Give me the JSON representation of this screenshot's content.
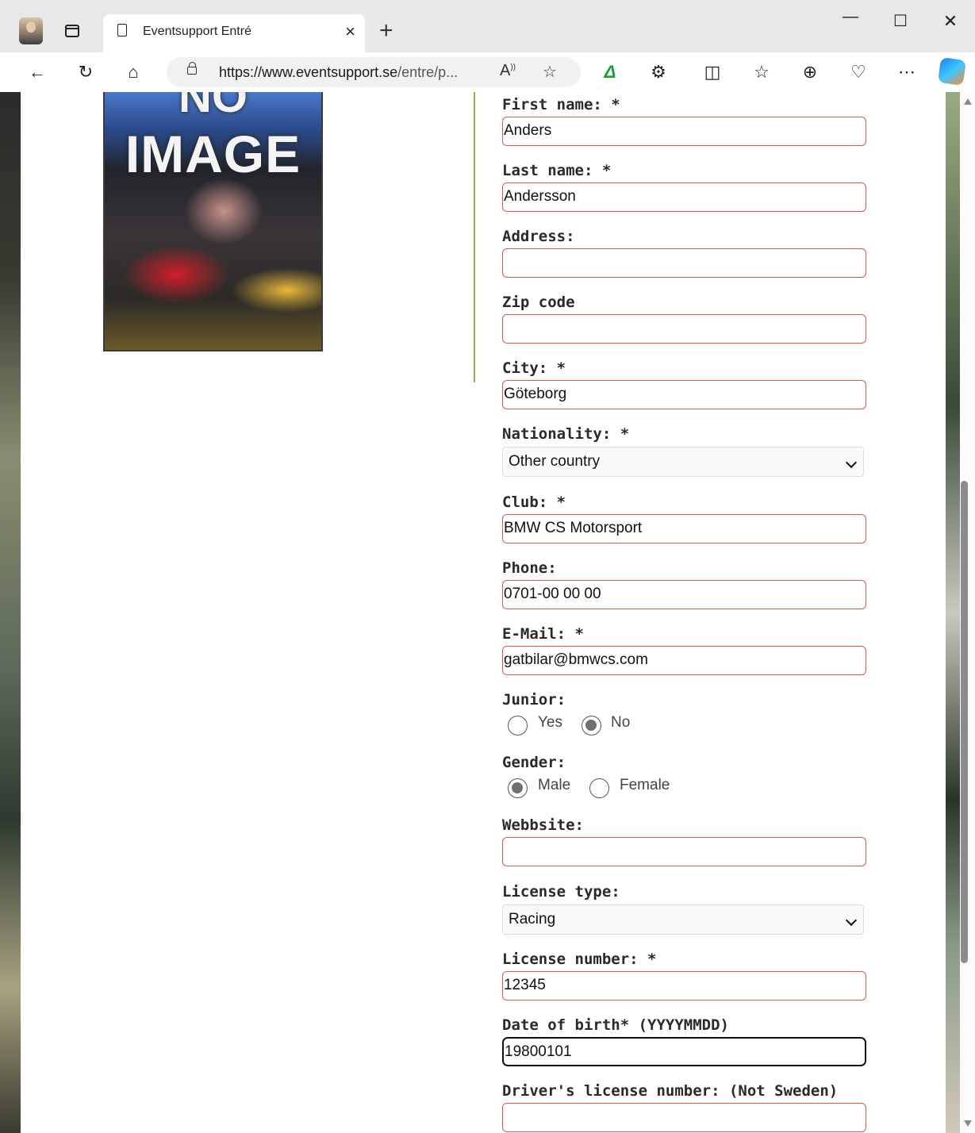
{
  "browser": {
    "tab_title": "Eventsupport Entré",
    "url_host": "https://www.eventsupport.se",
    "url_rest": "/entre/p...",
    "icons": [
      "back-icon",
      "refresh-icon",
      "home-icon",
      "lock-icon",
      "read-aloud-icon",
      "favorite-star-icon",
      "grammar-extension-icon",
      "extensions-icon",
      "split-screen-icon",
      "favorites-icon",
      "collections-icon",
      "browser-essentials-icon",
      "more-icon",
      "copilot-icon"
    ]
  },
  "image": {
    "line1": "NO",
    "line2": "IMAGE"
  },
  "form": {
    "first_name": {
      "label": "First name: *",
      "value": "Anders"
    },
    "last_name": {
      "label": "Last name: *",
      "value": "Andersson"
    },
    "address": {
      "label": "Address:",
      "value": ""
    },
    "zip": {
      "label": "Zip code",
      "value": ""
    },
    "city": {
      "label": "City: *",
      "value": "Göteborg"
    },
    "nationality": {
      "label": "Nationality: *",
      "value": "Other country"
    },
    "club": {
      "label": "Club: *",
      "value": "BMW CS Motorsport"
    },
    "phone": {
      "label": "Phone:",
      "value": "0701-00 00 00"
    },
    "email": {
      "label": "E-Mail: *",
      "value": "gatbilar@bmwcs.com"
    },
    "junior": {
      "label": "Junior:",
      "yes": "Yes",
      "no": "No",
      "selected": "No"
    },
    "gender": {
      "label": "Gender:",
      "male": "Male",
      "female": "Female",
      "selected": "Male"
    },
    "website": {
      "label": "Webbsite:",
      "value": ""
    },
    "license_type": {
      "label": "License type:",
      "value": "Racing"
    },
    "license_number": {
      "label": "License number: *",
      "value": "12345"
    },
    "dob": {
      "label": "Date of birth* (YYYYMMDD)",
      "value": "19800101"
    },
    "drivers_license": {
      "label": "Driver's license number: (Not Sweden)",
      "value": ""
    }
  }
}
